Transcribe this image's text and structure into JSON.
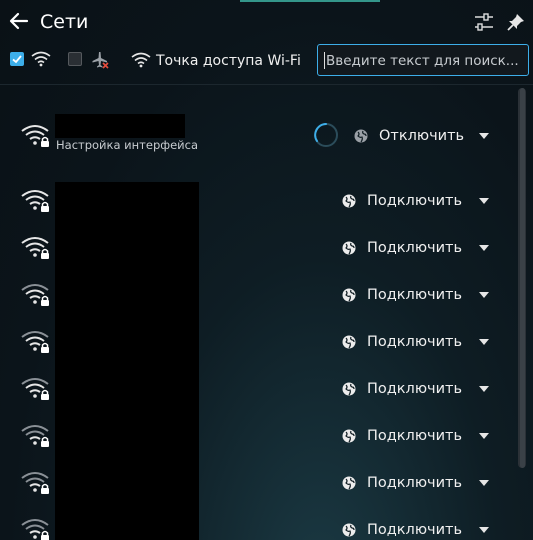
{
  "header": {
    "title": "Сети",
    "back_icon": "arrow-left-icon",
    "configure_icon": "configure-sliders-icon",
    "pin_icon": "pin-icon"
  },
  "toolbar": {
    "wifi_enabled": true,
    "airplane_enabled": false,
    "hotspot_label": "Точка доступа Wi-Fi",
    "search_placeholder": "Введите текст для поиск..."
  },
  "networks": [
    {
      "status": "Настройка интерфейса",
      "action": "Отключить",
      "connecting": true
    },
    {
      "action": "Подключить"
    },
    {
      "action": "Подключить"
    },
    {
      "action": "Подключить"
    },
    {
      "action": "Подключить"
    },
    {
      "action": "Подключить"
    },
    {
      "action": "Подключить"
    },
    {
      "action": "Подключить"
    },
    {
      "action": "Подключить"
    }
  ],
  "colors": {
    "accent": "#3daee9",
    "background": "#0b141a",
    "text": "#f0f0f0"
  }
}
